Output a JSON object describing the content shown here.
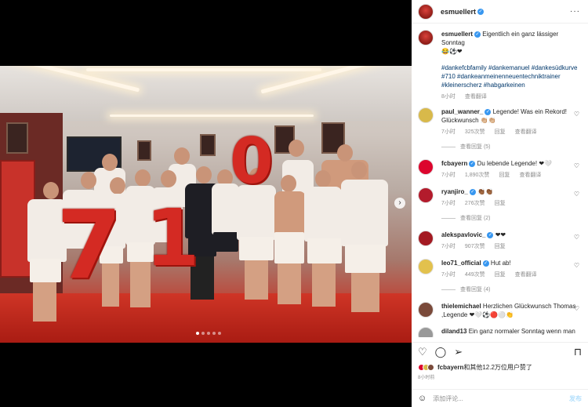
{
  "post": {
    "author": "esmuellert",
    "caption": "Eigentlich ein ganz lässiger Sonntag",
    "caption_emoji": "😂⚽❤",
    "hashtags": "#dankefcbfamily #dankemanuel #dankesüdkurve #710 #dankeanmeinenneuentechniktrainer #kleinerscherz #habgarkeinen",
    "time": "8小时",
    "translate": "查看翻译",
    "balloon_number": "710"
  },
  "comments": [
    {
      "user": "paul_wanner_",
      "verified": true,
      "text": "Legende! Was ein Rekord! Glückwunsch 👏🏼👏🏼",
      "time": "7小时",
      "likes": "325次赞",
      "reply": "回复",
      "translate": "查看翻译",
      "replies": "查看回复 (5)",
      "avatar_color": "#d8b94a"
    },
    {
      "user": "fcbayern",
      "verified": true,
      "text": "Du lebende Legende! ❤🤍",
      "time": "7小时",
      "likes": "1,890次赞",
      "reply": "回复",
      "translate": "查看翻译",
      "replies": "",
      "avatar_color": "#dc052d"
    },
    {
      "user": "ryanjiro_",
      "verified": true,
      "text": "👏🏾👏🏾",
      "time": "7小时",
      "likes": "276次赞",
      "reply": "回复",
      "translate": "",
      "replies": "查看回复 (2)",
      "avatar_color": "#b31b2c"
    },
    {
      "user": "alekspavlovic_",
      "verified": true,
      "text": "❤❤",
      "time": "7小时",
      "likes": "907次赞",
      "reply": "回复",
      "translate": "",
      "replies": "",
      "avatar_color": "#a31a22"
    },
    {
      "user": "leo71_official",
      "verified": true,
      "text": "Hut ab!",
      "time": "7小时",
      "likes": "449次赞",
      "reply": "回复",
      "translate": "查看翻译",
      "replies": "查看回复 (4)",
      "avatar_color": "#e2c14d"
    },
    {
      "user": "thielemichael",
      "verified": false,
      "text": "Herzlichen Glückwunsch Thomas ,Legende ❤🤍⚽🔴⚪👏",
      "time": "",
      "likes": "",
      "reply": "",
      "translate": "",
      "replies": "",
      "avatar_color": "#7a4a3a"
    },
    {
      "user": "diland13",
      "verified": false,
      "text": "Ein ganz normaler Sonntag wenn man",
      "time": "",
      "likes": "",
      "reply": "",
      "translate": "",
      "replies": "",
      "avatar_color": "#999999"
    }
  ],
  "actions": {
    "like": "♡",
    "comment": "💬",
    "share": "➤",
    "save": "🔖"
  },
  "likes_line": {
    "prefix": "fcbayern",
    "rest": "和其他12.2万位用户赞了"
  },
  "post_time": "8小时前",
  "add_comment": {
    "placeholder": "添加评论...",
    "post": "发布"
  },
  "colors": {
    "accent": "#3897f0",
    "link": "#00376b",
    "bayern_red": "#dc052d"
  }
}
